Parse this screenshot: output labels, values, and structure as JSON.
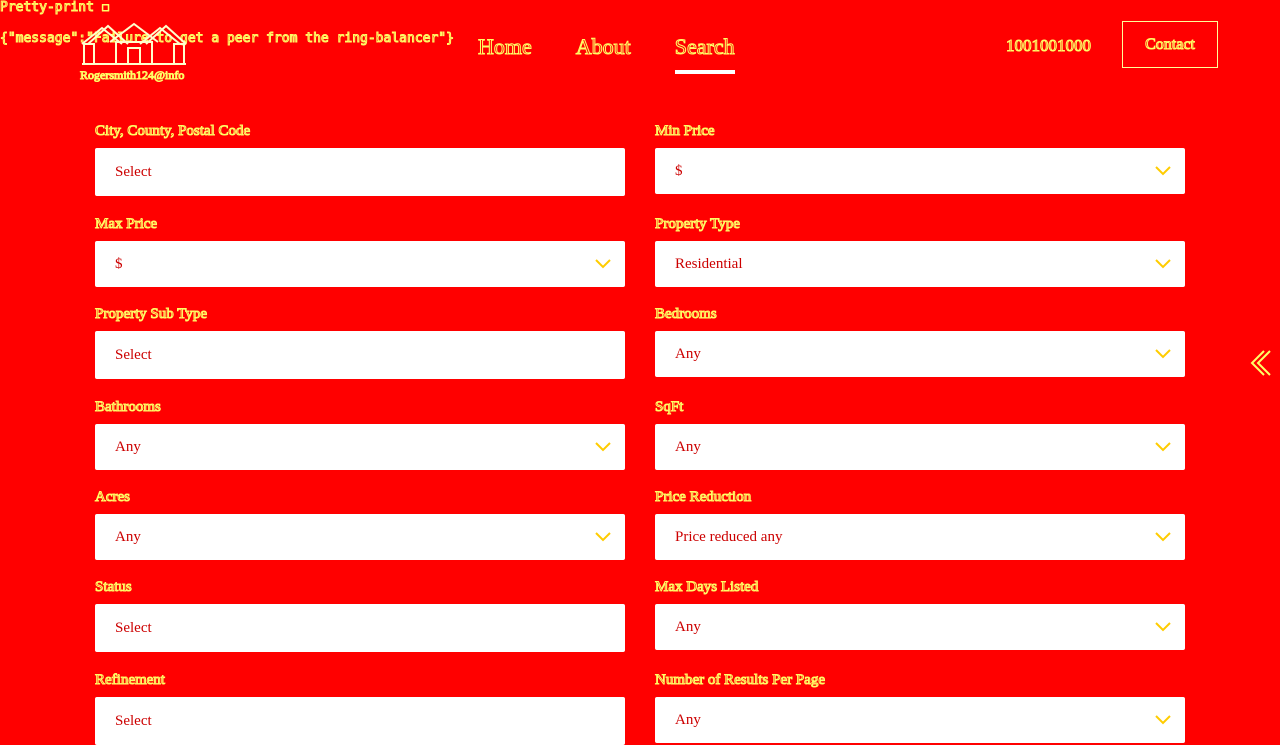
{
  "debug": {
    "pretty_print": "Pretty-print ☐",
    "message_json": "{\"message\":\"Failure to get a peer from the ring-balancer\"}"
  },
  "brand": {
    "logo_icon": "house-logo-icon",
    "tagline": "Rogersmith124@info"
  },
  "nav": {
    "tabs": [
      {
        "label": "Home",
        "active": false
      },
      {
        "label": "About",
        "active": false
      },
      {
        "label": "Search",
        "active": true
      }
    ]
  },
  "header": {
    "phone": "1001001000",
    "contact_label": "Contact"
  },
  "side_toggle_icon": "chevron-left-double-icon",
  "form": {
    "fields": [
      {
        "label": "City, County, Postal Code",
        "value": "Select",
        "dropdown": false
      },
      {
        "label": "Min Price",
        "value": "$",
        "dropdown": true
      },
      {
        "label": "Max Price",
        "value": "$",
        "dropdown": true
      },
      {
        "label": "Property Type",
        "value": "Residential",
        "dropdown": true
      },
      {
        "label": "Property Sub Type",
        "value": "Select",
        "dropdown": false
      },
      {
        "label": "Bedrooms",
        "value": "Any",
        "dropdown": true
      },
      {
        "label": "Bathrooms",
        "value": "Any",
        "dropdown": true
      },
      {
        "label": "SqFt",
        "value": "Any",
        "dropdown": true
      },
      {
        "label": "Acres",
        "value": "Any",
        "dropdown": true
      },
      {
        "label": "Price Reduction",
        "value": "Price reduced any",
        "dropdown": true
      },
      {
        "label": "Status",
        "value": "Select",
        "dropdown": false
      },
      {
        "label": "Max Days Listed",
        "value": "Any",
        "dropdown": true
      },
      {
        "label": "Refinement",
        "value": "Select",
        "dropdown": false
      },
      {
        "label": "Number of Results Per Page",
        "value": "Any",
        "dropdown": true
      }
    ]
  },
  "colors": {
    "background": "#ff0000",
    "text": "#ffff66",
    "input_bg": "#ffffff",
    "input_text": "#cc0000"
  }
}
